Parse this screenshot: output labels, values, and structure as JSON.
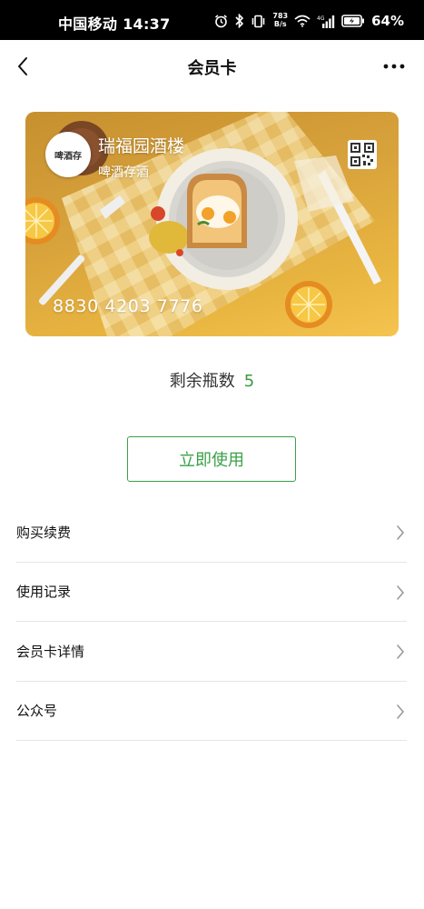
{
  "status_bar": {
    "carrier": "中国移动",
    "time": "14:37",
    "net_speed_value": "783",
    "net_speed_unit": "B/s",
    "network_type": "4G",
    "battery_percent": "64%"
  },
  "nav": {
    "title": "会员卡"
  },
  "card": {
    "logo_text": "啤酒存",
    "merchant_name": "瑞福园酒楼",
    "card_type": "啤酒存酒",
    "card_number": "8830 4203 7776",
    "theme_color": "#d9a43c"
  },
  "remaining": {
    "label": "剩余瓶数",
    "value": "5"
  },
  "actions": {
    "use_label": "立即使用",
    "accent_color": "#3aa047"
  },
  "menu": {
    "items": [
      {
        "label": "购买续费"
      },
      {
        "label": "使用记录"
      },
      {
        "label": "会员卡详情"
      },
      {
        "label": "公众号"
      }
    ]
  }
}
